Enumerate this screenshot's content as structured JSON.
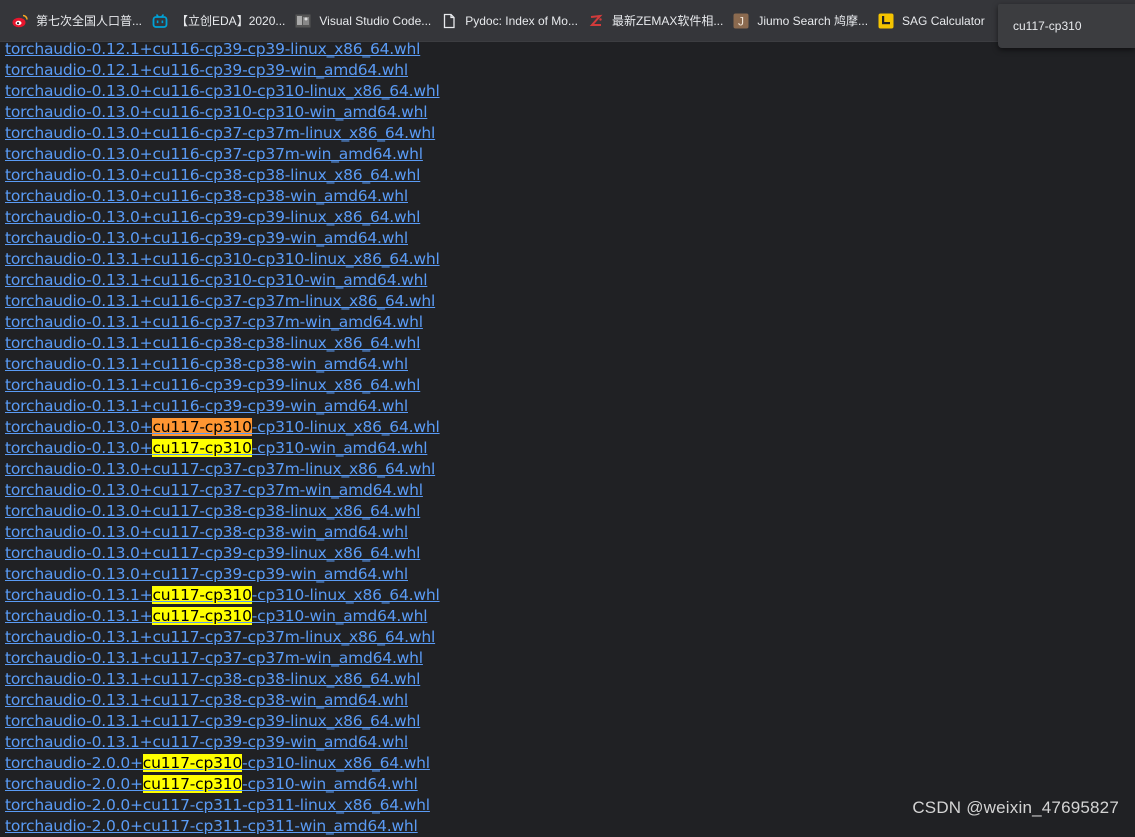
{
  "bookmarks": [
    {
      "label": "第七次全国人口普...",
      "icon": "weibo-icon",
      "color": "#e6162d"
    },
    {
      "label": "【立创EDA】2020...",
      "icon": "bilibili-icon",
      "color": "#00a1d6"
    },
    {
      "label": "Visual Studio Code...",
      "icon": "image-thumbnail-icon",
      "color": "#7a7a7a"
    },
    {
      "label": "Pydoc: Index of Mo...",
      "icon": "document-icon",
      "color": "#e8eaed"
    },
    {
      "label": "最新ZEMAX软件相...",
      "icon": "zemax-icon",
      "color": "#d23b3b"
    },
    {
      "label": "Jiumo Search 鸠摩...",
      "icon": "letter-j-icon",
      "color": "#8b6a4f"
    },
    {
      "label": "SAG Calculator",
      "icon": "calculator-icon",
      "color": "#f5c400"
    }
  ],
  "find_bar": {
    "query": "cu117-cp310"
  },
  "highlight_term": "cu117-cp310",
  "active_match_index": 0,
  "links": [
    "torchaudio-0.12.1+cu116-cp39-cp39-linux_x86_64.whl",
    "torchaudio-0.12.1+cu116-cp39-cp39-win_amd64.whl",
    "torchaudio-0.13.0+cu116-cp310-cp310-linux_x86_64.whl",
    "torchaudio-0.13.0+cu116-cp310-cp310-win_amd64.whl",
    "torchaudio-0.13.0+cu116-cp37-cp37m-linux_x86_64.whl",
    "torchaudio-0.13.0+cu116-cp37-cp37m-win_amd64.whl",
    "torchaudio-0.13.0+cu116-cp38-cp38-linux_x86_64.whl",
    "torchaudio-0.13.0+cu116-cp38-cp38-win_amd64.whl",
    "torchaudio-0.13.0+cu116-cp39-cp39-linux_x86_64.whl",
    "torchaudio-0.13.0+cu116-cp39-cp39-win_amd64.whl",
    "torchaudio-0.13.1+cu116-cp310-cp310-linux_x86_64.whl",
    "torchaudio-0.13.1+cu116-cp310-cp310-win_amd64.whl",
    "torchaudio-0.13.1+cu116-cp37-cp37m-linux_x86_64.whl",
    "torchaudio-0.13.1+cu116-cp37-cp37m-win_amd64.whl",
    "torchaudio-0.13.1+cu116-cp38-cp38-linux_x86_64.whl",
    "torchaudio-0.13.1+cu116-cp38-cp38-win_amd64.whl",
    "torchaudio-0.13.1+cu116-cp39-cp39-linux_x86_64.whl",
    "torchaudio-0.13.1+cu116-cp39-cp39-win_amd64.whl",
    "torchaudio-0.13.0+cu117-cp310-cp310-linux_x86_64.whl",
    "torchaudio-0.13.0+cu117-cp310-cp310-win_amd64.whl",
    "torchaudio-0.13.0+cu117-cp37-cp37m-linux_x86_64.whl",
    "torchaudio-0.13.0+cu117-cp37-cp37m-win_amd64.whl",
    "torchaudio-0.13.0+cu117-cp38-cp38-linux_x86_64.whl",
    "torchaudio-0.13.0+cu117-cp38-cp38-win_amd64.whl",
    "torchaudio-0.13.0+cu117-cp39-cp39-linux_x86_64.whl",
    "torchaudio-0.13.0+cu117-cp39-cp39-win_amd64.whl",
    "torchaudio-0.13.1+cu117-cp310-cp310-linux_x86_64.whl",
    "torchaudio-0.13.1+cu117-cp310-cp310-win_amd64.whl",
    "torchaudio-0.13.1+cu117-cp37-cp37m-linux_x86_64.whl",
    "torchaudio-0.13.1+cu117-cp37-cp37m-win_amd64.whl",
    "torchaudio-0.13.1+cu117-cp38-cp38-linux_x86_64.whl",
    "torchaudio-0.13.1+cu117-cp38-cp38-win_amd64.whl",
    "torchaudio-0.13.1+cu117-cp39-cp39-linux_x86_64.whl",
    "torchaudio-0.13.1+cu117-cp39-cp39-win_amd64.whl",
    "torchaudio-2.0.0+cu117-cp310-cp310-linux_x86_64.whl",
    "torchaudio-2.0.0+cu117-cp310-cp310-win_amd64.whl",
    "torchaudio-2.0.0+cu117-cp311-cp311-linux_x86_64.whl",
    "torchaudio-2.0.0+cu117-cp311-cp311-win_amd64.whl"
  ],
  "watermark": "CSDN @weixin_47695827",
  "colors": {
    "page_background": "#202124",
    "bookmarks_bar": "#35363a",
    "link": "#5a9bf5",
    "find_match": "#ffff00",
    "find_active_match": "#ff9632"
  }
}
